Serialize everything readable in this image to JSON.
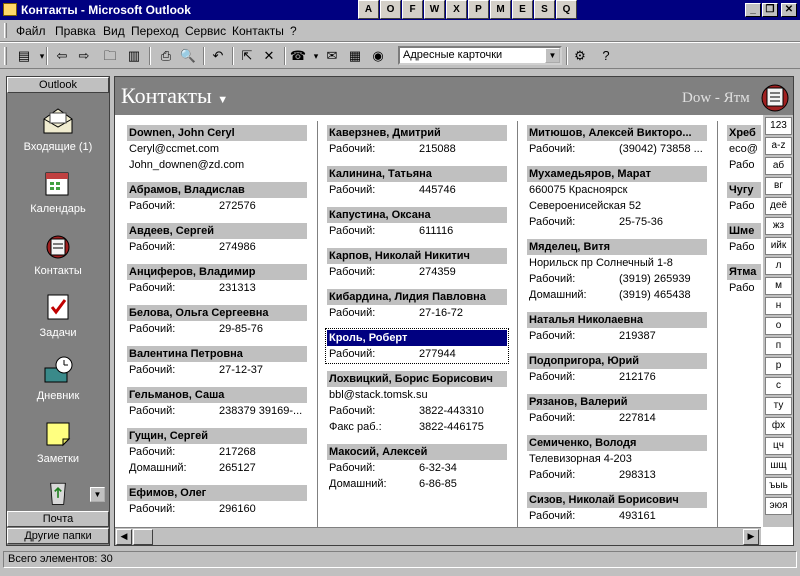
{
  "window": {
    "title": "Контакты - Microsoft Outlook",
    "minimize": "_",
    "restore": "❐",
    "close": "✕"
  },
  "taskbar_icons": [
    "A",
    "O",
    "F",
    "W",
    "X",
    "P",
    "M",
    "E",
    "S",
    "Q"
  ],
  "menu": [
    "Файл",
    "Правка",
    "Вид",
    "Переход",
    "Сервис",
    "Контакты",
    "?"
  ],
  "toolbar": {
    "address_cards_label": "Адресные карточки"
  },
  "sidebar": {
    "header": "Outlook",
    "items": [
      {
        "label": "Входящие (1)",
        "icon": "inbox-icon"
      },
      {
        "label": "Календарь",
        "icon": "calendar-icon"
      },
      {
        "label": "Контакты",
        "icon": "contacts-icon"
      },
      {
        "label": "Задачи",
        "icon": "tasks-icon"
      },
      {
        "label": "Дневник",
        "icon": "journal-icon"
      },
      {
        "label": "Заметки",
        "icon": "notes-icon"
      }
    ],
    "group_mail": "Почта",
    "group_other": "Другие папки"
  },
  "main": {
    "title": "Контакты",
    "range": "Dow - Ятм"
  },
  "columns": [
    [
      {
        "name": "Downen, John Ceryl",
        "lines": [
          {
            "label": "",
            "value": "Ceryl@ccmet.com"
          },
          {
            "label": "",
            "value": "John_downen@zd.com"
          }
        ]
      },
      {
        "name": "Абрамов, Владислав",
        "lines": [
          {
            "label": "Рабочий:",
            "value": "272576"
          }
        ]
      },
      {
        "name": "Авдеев, Сергей",
        "lines": [
          {
            "label": "Рабочий:",
            "value": "274986"
          }
        ]
      },
      {
        "name": "Анциферов, Владимир",
        "lines": [
          {
            "label": "Рабочий:",
            "value": "231313"
          }
        ]
      },
      {
        "name": "Белова, Ольга Сергеевна",
        "lines": [
          {
            "label": "Рабочий:",
            "value": "29-85-76"
          }
        ]
      },
      {
        "name": "Валентина Петровна",
        "lines": [
          {
            "label": "Рабочий:",
            "value": "27-12-37"
          }
        ]
      },
      {
        "name": "Гельманов, Саша",
        "lines": [
          {
            "label": "Рабочий:",
            "value": "238379 39169-..."
          }
        ]
      },
      {
        "name": "Гущин, Сергей",
        "lines": [
          {
            "label": "Рабочий:",
            "value": "217268"
          },
          {
            "label": "Домашний:",
            "value": "265127"
          }
        ]
      },
      {
        "name": "Ефимов, Олег",
        "lines": [
          {
            "label": "Рабочий:",
            "value": "296160"
          }
        ]
      }
    ],
    [
      {
        "name": "Каверзнев, Дмитрий",
        "lines": [
          {
            "label": "Рабочий:",
            "value": "215088"
          }
        ]
      },
      {
        "name": "Калинина, Татьяна",
        "lines": [
          {
            "label": "Рабочий:",
            "value": "445746"
          }
        ]
      },
      {
        "name": "Капустина, Оксана",
        "lines": [
          {
            "label": "Рабочий:",
            "value": "611116"
          }
        ]
      },
      {
        "name": "Карпов, Николай Никитич",
        "lines": [
          {
            "label": "Рабочий:",
            "value": "274359"
          }
        ]
      },
      {
        "name": "Кибардина, Лидия Павловна",
        "lines": [
          {
            "label": "Рабочий:",
            "value": "27-16-72"
          }
        ]
      },
      {
        "name": "Кроль, Роберт",
        "selected": true,
        "lines": [
          {
            "label": "Рабочий:",
            "value": "277944"
          }
        ]
      },
      {
        "name": "Лохвицкий, Борис Борисович",
        "lines": [
          {
            "label": "",
            "value": "bbl@stack.tomsk.su"
          },
          {
            "label": "Рабочий:",
            "value": "3822-443310"
          },
          {
            "label": "Факс раб.:",
            "value": "3822-446175"
          }
        ]
      },
      {
        "name": "Макосий, Алексей",
        "lines": [
          {
            "label": "Рабочий:",
            "value": "6-32-34"
          },
          {
            "label": "Домашний:",
            "value": "6-86-85"
          }
        ]
      }
    ],
    [
      {
        "name": "Митюшов, Алексей Викторо...",
        "lines": [
          {
            "label": "Рабочий:",
            "value": "(39042) 73858 ..."
          }
        ]
      },
      {
        "name": "Мухамедьяров, Марат",
        "lines": [
          {
            "label": "",
            "value": "660075  Красноярск"
          },
          {
            "label": "",
            "value": "Североенисейская 52"
          },
          {
            "label": "Рабочий:",
            "value": "25-75-36"
          }
        ]
      },
      {
        "name": "Мяделец, Витя",
        "lines": [
          {
            "label": "",
            "value": "Норильск пр Солнечный 1-8"
          },
          {
            "label": "Рабочий:",
            "value": "(3919) 265939"
          },
          {
            "label": "Домашний:",
            "value": "(3919) 465438"
          }
        ]
      },
      {
        "name": "Наталья Николаевна",
        "lines": [
          {
            "label": "Рабочий:",
            "value": "219387"
          }
        ]
      },
      {
        "name": "Подопригора, Юрий",
        "lines": [
          {
            "label": "Рабочий:",
            "value": "212176"
          }
        ]
      },
      {
        "name": "Рязанов, Валерий",
        "lines": [
          {
            "label": "Рабочий:",
            "value": "227814"
          }
        ]
      },
      {
        "name": "Семиченко, Володя",
        "lines": [
          {
            "label": "",
            "value": "Телевизорная 4-203"
          },
          {
            "label": "Рабочий:",
            "value": "298313"
          }
        ]
      },
      {
        "name": "Сизов, Николай Борисович",
        "lines": [
          {
            "label": "Рабочий:",
            "value": "493161"
          }
        ]
      }
    ],
    [
      {
        "name": "Хреб",
        "lines": [
          {
            "label": "",
            "value": "eco@"
          },
          {
            "label": "Рабо",
            "value": ""
          }
        ]
      },
      {
        "name": "Чугу",
        "lines": [
          {
            "label": "Рабо",
            "value": ""
          }
        ]
      },
      {
        "name": "Шме",
        "lines": [
          {
            "label": "Рабо",
            "value": ""
          }
        ]
      },
      {
        "name": "Ятма",
        "lines": [
          {
            "label": "Рабо",
            "value": ""
          }
        ]
      }
    ]
  ],
  "alpha_index": [
    "123",
    "a-z",
    "аб",
    "вг",
    "деё",
    "жз",
    "ийк",
    "л",
    "м",
    "н",
    "о",
    "п",
    "р",
    "с",
    "ту",
    "фх",
    "цч",
    "шщ",
    "ъыь",
    "эюя"
  ],
  "status": "Всего элементов: 30"
}
